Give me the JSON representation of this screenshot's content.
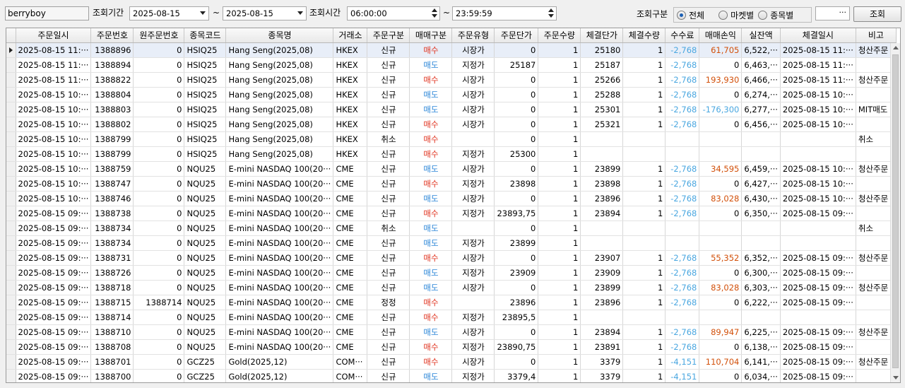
{
  "toolbar": {
    "user_id": "berryboy",
    "period_label": "조회기간",
    "date_from": "2025-08-15",
    "tilde": "~",
    "date_to": "2025-08-15",
    "time_label": "조회시간",
    "time_from": "06:00:00",
    "time_to": "23:59:59",
    "filter_label": "조회구분",
    "filter_options": [
      {
        "label": "전체",
        "selected": true
      },
      {
        "label": "마켓별",
        "selected": false
      },
      {
        "label": "종목별",
        "selected": false
      }
    ],
    "ellipsis_button": "···",
    "search_button": "조회"
  },
  "grid": {
    "columns": [
      "주문일시",
      "주문번호",
      "원주문번호",
      "종목코드",
      "종목명",
      "거래소",
      "주문구분",
      "매매구분",
      "주문유형",
      "주문단가",
      "주문수량",
      "체결단가",
      "체결수량",
      "수수료",
      "매매손익",
      "실잔액",
      "체결일시",
      "비고"
    ],
    "rows": [
      [
        "2025-08-15 11:···",
        "1388896",
        "0",
        "HSIQ25",
        "Hang Seng(2025,08)",
        "HKEX",
        "신규",
        "매수",
        "시장가",
        "0",
        "1",
        "25180",
        "1",
        "-2,768",
        "61,705",
        "6,522,···",
        "2025-08-15 11:···",
        "청산주문"
      ],
      [
        "2025-08-15 11:···",
        "1388894",
        "0",
        "HSIQ25",
        "Hang Seng(2025,08)",
        "HKEX",
        "신규",
        "매도",
        "지정가",
        "25187",
        "1",
        "25187",
        "1",
        "-2,768",
        "0",
        "6,463,···",
        "2025-08-15 11:···",
        ""
      ],
      [
        "2025-08-15 11:···",
        "1388822",
        "0",
        "HSIQ25",
        "Hang Seng(2025,08)",
        "HKEX",
        "신규",
        "매수",
        "시장가",
        "0",
        "1",
        "25266",
        "1",
        "-2,768",
        "193,930",
        "6,466,···",
        "2025-08-15 11:···",
        "청산주문"
      ],
      [
        "2025-08-15 10:···",
        "1388804",
        "0",
        "HSIQ25",
        "Hang Seng(2025,08)",
        "HKEX",
        "신규",
        "매도",
        "시장가",
        "0",
        "1",
        "25288",
        "1",
        "-2,768",
        "0",
        "6,274,···",
        "2025-08-15 10:···",
        ""
      ],
      [
        "2025-08-15 10:···",
        "1388803",
        "0",
        "HSIQ25",
        "Hang Seng(2025,08)",
        "HKEX",
        "신규",
        "매도",
        "시장가",
        "0",
        "1",
        "25301",
        "1",
        "-2,768",
        "-176,300",
        "6,277,···",
        "2025-08-15 10:···",
        "MIT매도"
      ],
      [
        "2025-08-15 10:···",
        "1388802",
        "0",
        "HSIQ25",
        "Hang Seng(2025,08)",
        "HKEX",
        "신규",
        "매수",
        "시장가",
        "0",
        "1",
        "25321",
        "1",
        "-2,768",
        "0",
        "6,456,···",
        "2025-08-15 10:···",
        ""
      ],
      [
        "2025-08-15 10:···",
        "1388799",
        "0",
        "HSIQ25",
        "Hang Seng(2025,08)",
        "HKEX",
        "취소",
        "매수",
        "",
        "0",
        "1",
        "",
        "",
        "",
        "",
        "",
        "",
        "취소"
      ],
      [
        "2025-08-15 10:···",
        "1388799",
        "0",
        "HSIQ25",
        "Hang Seng(2025,08)",
        "HKEX",
        "신규",
        "매수",
        "지정가",
        "25300",
        "1",
        "",
        "",
        "",
        "",
        "",
        "",
        ""
      ],
      [
        "2025-08-15 10:···",
        "1388759",
        "0",
        "NQU25",
        "E-mini NASDAQ 100(20···",
        "CME",
        "신규",
        "매도",
        "시장가",
        "0",
        "1",
        "23899",
        "1",
        "-2,768",
        "34,595",
        "6,459,···",
        "2025-08-15 10:···",
        "청산주문"
      ],
      [
        "2025-08-15 10:···",
        "1388747",
        "0",
        "NQU25",
        "E-mini NASDAQ 100(20···",
        "CME",
        "신규",
        "매수",
        "지정가",
        "23898",
        "1",
        "23898",
        "1",
        "-2,768",
        "0",
        "6,427,···",
        "2025-08-15 10:···",
        ""
      ],
      [
        "2025-08-15 10:···",
        "1388746",
        "0",
        "NQU25",
        "E-mini NASDAQ 100(20···",
        "CME",
        "신규",
        "매도",
        "시장가",
        "0",
        "1",
        "23896",
        "1",
        "-2,768",
        "83,028",
        "6,430,···",
        "2025-08-15 10:···",
        "청산주문"
      ],
      [
        "2025-08-15 09:···",
        "1388738",
        "0",
        "NQU25",
        "E-mini NASDAQ 100(20···",
        "CME",
        "신규",
        "매수",
        "지정가",
        "23893,75",
        "1",
        "23894",
        "1",
        "-2,768",
        "0",
        "6,350,···",
        "2025-08-15 09:···",
        ""
      ],
      [
        "2025-08-15 09:···",
        "1388734",
        "0",
        "NQU25",
        "E-mini NASDAQ 100(20···",
        "CME",
        "취소",
        "매도",
        "",
        "0",
        "1",
        "",
        "",
        "",
        "",
        "",
        "",
        "취소"
      ],
      [
        "2025-08-15 09:···",
        "1388734",
        "0",
        "NQU25",
        "E-mini NASDAQ 100(20···",
        "CME",
        "신규",
        "매도",
        "지정가",
        "23899",
        "1",
        "",
        "",
        "",
        "",
        "",
        "",
        ""
      ],
      [
        "2025-08-15 09:···",
        "1388731",
        "0",
        "NQU25",
        "E-mini NASDAQ 100(20···",
        "CME",
        "신규",
        "매수",
        "시장가",
        "0",
        "1",
        "23907",
        "1",
        "-2,768",
        "55,352",
        "6,352,···",
        "2025-08-15 09:···",
        "청산주문"
      ],
      [
        "2025-08-15 09:···",
        "1388726",
        "0",
        "NQU25",
        "E-mini NASDAQ 100(20···",
        "CME",
        "신규",
        "매도",
        "지정가",
        "23909",
        "1",
        "23909",
        "1",
        "-2,768",
        "0",
        "6,300,···",
        "2025-08-15 09:···",
        ""
      ],
      [
        "2025-08-15 09:···",
        "1388718",
        "0",
        "NQU25",
        "E-mini NASDAQ 100(20···",
        "CME",
        "신규",
        "매도",
        "시장가",
        "0",
        "1",
        "23899",
        "1",
        "-2,768",
        "83,028",
        "6,303,···",
        "2025-08-15 09:···",
        "청산주문"
      ],
      [
        "2025-08-15 09:···",
        "1388715",
        "1388714",
        "NQU25",
        "E-mini NASDAQ 100(20···",
        "CME",
        "정정",
        "매수",
        "",
        "23896",
        "1",
        "23896",
        "1",
        "-2,768",
        "0",
        "6,222,···",
        "2025-08-15 09:···",
        ""
      ],
      [
        "2025-08-15 09:···",
        "1388714",
        "0",
        "NQU25",
        "E-mini NASDAQ 100(20···",
        "CME",
        "신규",
        "매수",
        "지정가",
        "23895,5",
        "1",
        "",
        "",
        "",
        "",
        "",
        "",
        ""
      ],
      [
        "2025-08-15 09:···",
        "1388710",
        "0",
        "NQU25",
        "E-mini NASDAQ 100(20···",
        "CME",
        "신규",
        "매도",
        "시장가",
        "0",
        "1",
        "23894",
        "1",
        "-2,768",
        "89,947",
        "6,225,···",
        "2025-08-15 09:···",
        "청산주문"
      ],
      [
        "2025-08-15 09:···",
        "1388708",
        "0",
        "NQU25",
        "E-mini NASDAQ 100(20···",
        "CME",
        "신규",
        "매수",
        "지정가",
        "23890,75",
        "1",
        "23891",
        "1",
        "-2,768",
        "0",
        "6,138,···",
        "2025-08-15 09:···",
        ""
      ],
      [
        "2025-08-15 09:···",
        "1388701",
        "0",
        "GCZ25",
        "Gold(2025,12)",
        "COM···",
        "신규",
        "매수",
        "시장가",
        "0",
        "1",
        "3379",
        "1",
        "-4,151",
        "110,704",
        "6,141,···",
        "2025-08-15 09:···",
        "청산주문"
      ],
      [
        "2025-08-15 09:···",
        "1388700",
        "0",
        "GCZ25",
        "Gold(2025,12)",
        "COM···",
        "신규",
        "매도",
        "지정가",
        "3379,4",
        "1",
        "3379",
        "1",
        "-4,151",
        "0",
        "6,034,···",
        "2025-08-15 09:···",
        ""
      ]
    ],
    "colors": {
      "buy": "#e0321e",
      "sell": "#2b86d8",
      "pl_positive": "#d2500a",
      "pl_negative": "#4aa7e0",
      "fee": "#4aa7e0"
    }
  }
}
